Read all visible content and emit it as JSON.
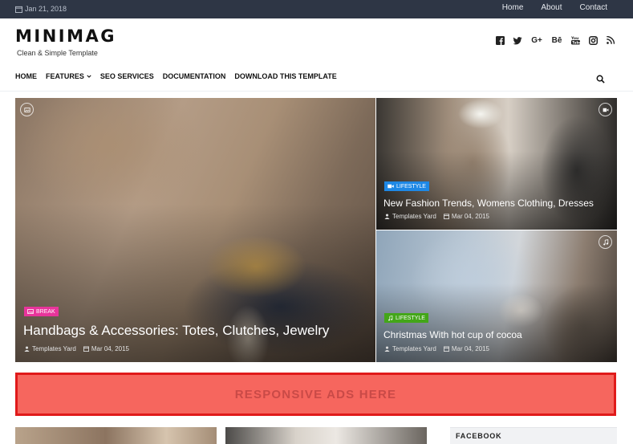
{
  "topbar": {
    "date": "Jan 21, 2018",
    "links": [
      "Home",
      "About",
      "Contact"
    ],
    "bg_color": "#2e3645"
  },
  "header": {
    "logo": "MINIMAG",
    "tagline": "Clean & Simple Template",
    "social_icons": [
      "facebook-icon",
      "twitter-icon",
      "google-plus-icon",
      "behance-icon",
      "youtube-icon",
      "instagram-icon",
      "rss-icon"
    ]
  },
  "nav": {
    "items": [
      "HOME",
      "FEATURES",
      "SEO SERVICES",
      "DOCUMENTATION",
      "DOWNLOAD THIS TEMPLATE"
    ],
    "search_icon": "search-icon"
  },
  "featured": {
    "big": {
      "badge": "BREAK",
      "badge_color": "#e8349b",
      "badge_icon": "image-icon",
      "corner_icon": "gallery-icon",
      "title": "Handbags & Accessories: Totes, Clutches, Jewelry",
      "author": "Templates Yard",
      "date": "Mar 04, 2015"
    },
    "top_right": {
      "badge": "LIFESTYLE",
      "badge_color": "#1e88e5",
      "badge_icon": "video-icon",
      "corner_icon": "video-icon",
      "title": "New Fashion Trends, Womens Clothing, Dresses",
      "author": "Templates Yard",
      "date": "Mar 04, 2015"
    },
    "bottom_right": {
      "badge": "LIFESTYLE",
      "badge_color": "#43a619",
      "badge_icon": "music-icon",
      "corner_icon": "music-icon",
      "title": "Christmas With hot cup of cocoa",
      "author": "Templates Yard",
      "date": "Mar 04, 2015"
    }
  },
  "ads": {
    "text": "RESPONSIVE ADS HERE",
    "bg_color": "#f6665e",
    "border_color": "#e01a1a"
  },
  "sidebar": {
    "widget_title": "FACEBOOK"
  }
}
